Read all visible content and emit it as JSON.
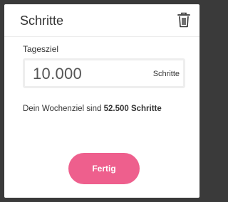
{
  "dialog": {
    "title": "Schritte",
    "delete_icon": "trash-icon"
  },
  "goal_field": {
    "label": "Tagesziel",
    "value": "10.000",
    "unit": "Schritte"
  },
  "weekly_goal": {
    "prefix": "Dein Wochenziel sind ",
    "amount": "52.500 Schritte"
  },
  "done_button": {
    "label": "Fertig",
    "color": "#ee5f8d"
  }
}
